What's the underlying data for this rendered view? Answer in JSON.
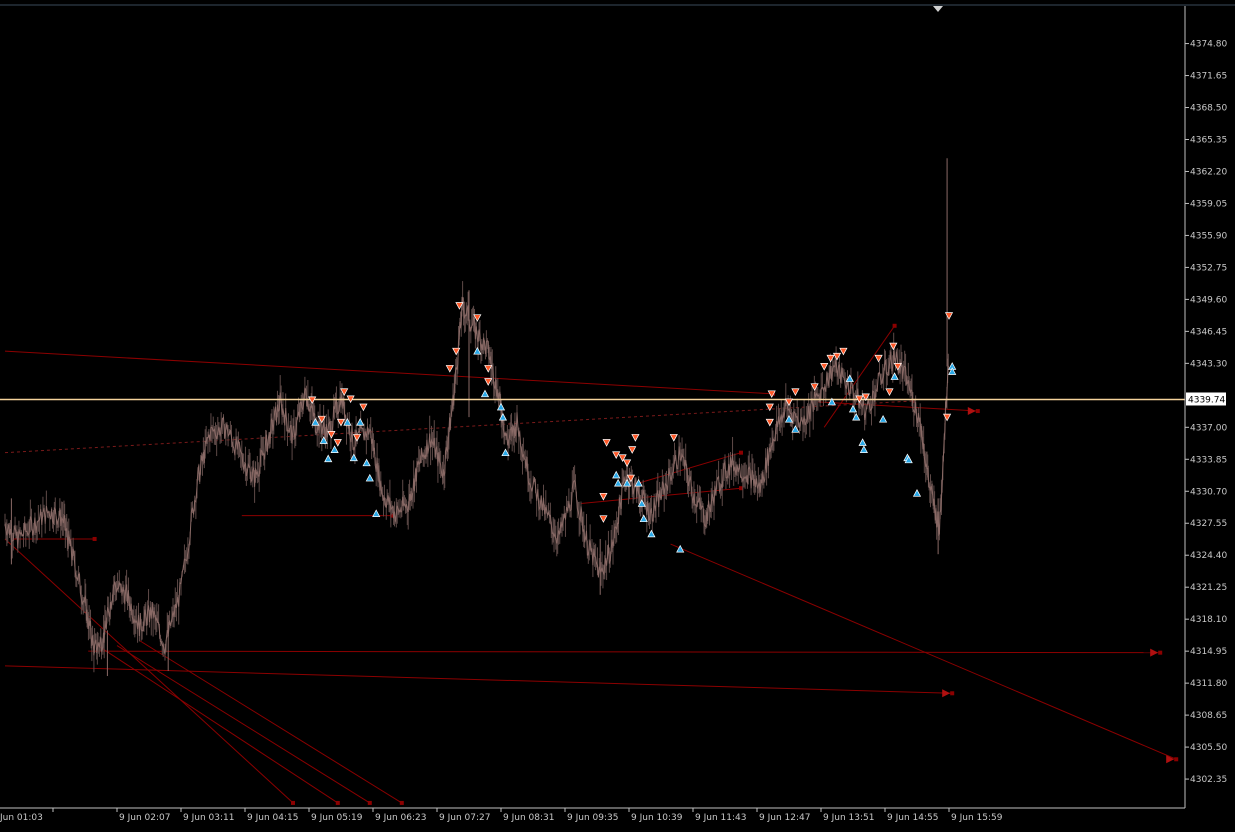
{
  "chart_data": {
    "type": "candlestick-line",
    "title": "",
    "xlabel": "",
    "ylabel": "",
    "ylim": [
      4299.5,
      4378.5
    ],
    "grid": false,
    "current_price": "4339.74",
    "x_ticks": [
      "Jun 01:03",
      "9 Jun 02:07",
      "9 Jun 03:11",
      "9 Jun 04:15",
      "9 Jun 05:19",
      "9 Jun 06:23",
      "9 Jun 07:27",
      "9 Jun 08:31",
      "9 Jun 09:35",
      "9 Jun 10:39",
      "9 Jun 11:43",
      "9 Jun 12:47",
      "9 Jun 13:51",
      "9 Jun 14:55",
      "9 Jun 15:59"
    ],
    "y_ticks": [
      "4374.80",
      "4371.65",
      "4368.50",
      "4365.35",
      "4362.20",
      "4359.05",
      "4355.90",
      "4352.75",
      "4349.60",
      "4346.45",
      "4343.30",
      "4337.00",
      "4333.85",
      "4330.70",
      "4327.55",
      "4324.40",
      "4321.25",
      "4318.10",
      "4314.95",
      "4311.80",
      "4308.65",
      "4305.50",
      "4302.35"
    ],
    "y_tick_values": [
      4374.8,
      4371.65,
      4368.5,
      4365.35,
      4362.2,
      4359.05,
      4355.9,
      4352.75,
      4349.6,
      4346.45,
      4343.3,
      4337.0,
      4333.85,
      4330.7,
      4327.55,
      4324.4,
      4321.25,
      4318.1,
      4314.95,
      4311.8,
      4308.65,
      4305.5,
      4302.35
    ],
    "x_tick_units": [
      0.4,
      1.4,
      2.4,
      3.4,
      4.4,
      5.4,
      6.4,
      7.4,
      8.4,
      9.4,
      10.4,
      11.4,
      12.4,
      13.4,
      14.4
    ],
    "x_max_units": 18.5,
    "price_path": [
      [
        0.0,
        4327.5
      ],
      [
        0.2,
        4326.0
      ],
      [
        0.45,
        4327.5
      ],
      [
        0.7,
        4328.8
      ],
      [
        0.9,
        4328.0
      ],
      [
        1.05,
        4324.5
      ],
      [
        1.25,
        4319.5
      ],
      [
        1.4,
        4315.0
      ],
      [
        1.55,
        4316.5
      ],
      [
        1.7,
        4321.5
      ],
      [
        1.9,
        4320.5
      ],
      [
        2.1,
        4317.5
      ],
      [
        2.3,
        4318.8
      ],
      [
        2.5,
        4315.5
      ],
      [
        2.75,
        4321.0
      ],
      [
        3.0,
        4331.5
      ],
      [
        3.2,
        4336.5
      ],
      [
        3.45,
        4337.0
      ],
      [
        3.7,
        4334.0
      ],
      [
        3.9,
        4332.0
      ],
      [
        4.1,
        4335.5
      ],
      [
        4.3,
        4339.5
      ],
      [
        4.5,
        4336.0
      ],
      [
        4.7,
        4340.5
      ],
      [
        4.85,
        4337.5
      ],
      [
        5.05,
        4336.5
      ],
      [
        5.25,
        4340.0
      ],
      [
        5.45,
        4335.5
      ],
      [
        5.7,
        4336.8
      ],
      [
        5.9,
        4330.5
      ],
      [
        6.1,
        4328.5
      ],
      [
        6.3,
        4329.5
      ],
      [
        6.45,
        4333.0
      ],
      [
        6.65,
        4336.0
      ],
      [
        6.85,
        4332.5
      ],
      [
        7.0,
        4339.5
      ],
      [
        7.15,
        4349.0
      ],
      [
        7.35,
        4346.5
      ],
      [
        7.55,
        4344.5
      ],
      [
        7.7,
        4340.5
      ],
      [
        7.85,
        4335.5
      ],
      [
        8.0,
        4337.5
      ],
      [
        8.2,
        4332.0
      ],
      [
        8.45,
        4328.5
      ],
      [
        8.65,
        4326.0
      ],
      [
        8.9,
        4331.0
      ],
      [
        9.1,
        4325.5
      ],
      [
        9.3,
        4322.5
      ],
      [
        9.5,
        4325.5
      ],
      [
        9.7,
        4332.5
      ],
      [
        9.9,
        4330.5
      ],
      [
        10.1,
        4328.5
      ],
      [
        10.3,
        4331.0
      ],
      [
        10.55,
        4334.5
      ],
      [
        10.75,
        4330.5
      ],
      [
        10.95,
        4328.0
      ],
      [
        11.15,
        4331.5
      ],
      [
        11.35,
        4333.5
      ],
      [
        11.6,
        4332.5
      ],
      [
        11.8,
        4331.0
      ],
      [
        12.0,
        4336.0
      ],
      [
        12.2,
        4339.0
      ],
      [
        12.45,
        4337.5
      ],
      [
        12.7,
        4340.0
      ],
      [
        12.95,
        4343.0
      ],
      [
        13.2,
        4341.0
      ],
      [
        13.45,
        4338.5
      ],
      [
        13.7,
        4342.0
      ],
      [
        13.9,
        4344.0
      ],
      [
        14.1,
        4341.5
      ],
      [
        14.3,
        4337.5
      ],
      [
        14.45,
        4331.0
      ],
      [
        14.6,
        4327.0
      ],
      [
        14.75,
        4345.0
      ]
    ],
    "candle_extremes": [
      [
        0.1,
        4323.5,
        4330.0
      ],
      [
        1.6,
        4312.5,
        4317.0
      ],
      [
        2.55,
        4313.0,
        4318.5
      ],
      [
        7.25,
        4350.5,
        4338.0
      ],
      [
        9.3,
        4320.5,
        4326.0
      ],
      [
        14.58,
        4324.5,
        4330.0
      ],
      [
        14.72,
        4343.0,
        4363.5
      ]
    ],
    "lines": [
      {
        "style": "solid",
        "color": "#8b0000",
        "from": [
          0.0,
          4344.5
        ],
        "to": [
          12.0,
          4340.3
        ]
      },
      {
        "style": "dashed",
        "color": "#7a1a1a",
        "from": [
          0.0,
          4334.5
        ],
        "to": [
          14.2,
          4339.6
        ]
      },
      {
        "style": "solid",
        "color": "#8b0000",
        "from": [
          0.1,
          4326.0
        ],
        "to": [
          1.4,
          4326.0
        ]
      },
      {
        "style": "solid",
        "color": "#8b0000",
        "from": [
          3.7,
          4328.3
        ],
        "to": [
          6.05,
          4328.3
        ]
      },
      {
        "style": "solid",
        "color": "#8b0000",
        "from": [
          1.3,
          4314.95
        ],
        "to": [
          18.05,
          4314.8
        ]
      },
      {
        "style": "solid",
        "color": "#8b0000",
        "from": [
          0.0,
          4313.5
        ],
        "to": [
          14.8,
          4310.8
        ]
      },
      {
        "style": "solid",
        "color": "#8b0000",
        "from": [
          10.4,
          4325.5
        ],
        "to": [
          18.3,
          4304.3
        ]
      },
      {
        "style": "solid",
        "color": "#8b0000",
        "from": [
          0.0,
          4326.0
        ],
        "to": [
          4.5,
          4300.0
        ]
      },
      {
        "style": "solid",
        "color": "#8b0000",
        "from": [
          1.45,
          4315.5
        ],
        "to": [
          5.2,
          4300.0
        ]
      },
      {
        "style": "solid",
        "color": "#8b0000",
        "from": [
          1.75,
          4315.5
        ],
        "to": [
          5.7,
          4300.0
        ]
      },
      {
        "style": "solid",
        "color": "#8b0000",
        "from": [
          2.1,
          4316.0
        ],
        "to": [
          6.2,
          4300.0
        ]
      },
      {
        "style": "solid",
        "color": "#8b0000",
        "from": [
          12.8,
          4337.0
        ],
        "to": [
          13.9,
          4347.0
        ]
      },
      {
        "style": "solid",
        "color": "#8b0000",
        "from": [
          12.7,
          4339.5
        ],
        "to": [
          15.2,
          4338.6
        ]
      },
      {
        "style": "solid",
        "color": "#8b0000",
        "from": [
          9.9,
          4331.5
        ],
        "to": [
          11.5,
          4334.5
        ]
      },
      {
        "style": "solid",
        "color": "#8b0000",
        "from": [
          9.0,
          4329.5
        ],
        "to": [
          11.5,
          4331.0
        ]
      }
    ],
    "signal_markers": [
      {
        "kind": "sell",
        "x": 4.8,
        "y": 4339.7
      },
      {
        "kind": "buy",
        "x": 4.85,
        "y": 4337.5
      },
      {
        "kind": "sell",
        "x": 4.95,
        "y": 4337.8
      },
      {
        "kind": "buy",
        "x": 4.98,
        "y": 4335.7
      },
      {
        "kind": "buy",
        "x": 5.05,
        "y": 4333.9
      },
      {
        "kind": "sell",
        "x": 5.1,
        "y": 4336.3
      },
      {
        "kind": "buy",
        "x": 5.15,
        "y": 4334.8
      },
      {
        "kind": "sell",
        "x": 5.2,
        "y": 4335.5
      },
      {
        "kind": "sell",
        "x": 5.25,
        "y": 4337.5
      },
      {
        "kind": "sell",
        "x": 5.3,
        "y": 4340.5
      },
      {
        "kind": "buy",
        "x": 5.35,
        "y": 4337.5
      },
      {
        "kind": "sell",
        "x": 5.4,
        "y": 4339.8
      },
      {
        "kind": "buy",
        "x": 5.45,
        "y": 4334.0
      },
      {
        "kind": "sell",
        "x": 5.5,
        "y": 4336.0
      },
      {
        "kind": "buy",
        "x": 5.55,
        "y": 4337.5
      },
      {
        "kind": "sell",
        "x": 5.6,
        "y": 4339.0
      },
      {
        "kind": "buy",
        "x": 5.65,
        "y": 4333.5
      },
      {
        "kind": "buy",
        "x": 5.7,
        "y": 4332.0
      },
      {
        "kind": "buy",
        "x": 5.8,
        "y": 4328.5
      },
      {
        "kind": "sell",
        "x": 6.95,
        "y": 4342.8
      },
      {
        "kind": "sell",
        "x": 7.05,
        "y": 4344.5
      },
      {
        "kind": "sell",
        "x": 7.1,
        "y": 4349.0
      },
      {
        "kind": "buy",
        "x": 7.38,
        "y": 4344.5
      },
      {
        "kind": "sell",
        "x": 7.38,
        "y": 4347.8
      },
      {
        "kind": "sell",
        "x": 7.55,
        "y": 4342.8
      },
      {
        "kind": "sell",
        "x": 7.55,
        "y": 4341.5
      },
      {
        "kind": "buy",
        "x": 7.5,
        "y": 4340.3
      },
      {
        "kind": "buy",
        "x": 7.75,
        "y": 4339.0
      },
      {
        "kind": "buy",
        "x": 7.78,
        "y": 4338.0
      },
      {
        "kind": "buy",
        "x": 7.82,
        "y": 4334.5
      },
      {
        "kind": "sell",
        "x": 9.4,
        "y": 4335.5
      },
      {
        "kind": "sell",
        "x": 9.55,
        "y": 4334.3
      },
      {
        "kind": "sell",
        "x": 9.65,
        "y": 4334.0
      },
      {
        "kind": "sell",
        "x": 9.72,
        "y": 4333.5
      },
      {
        "kind": "sell",
        "x": 9.8,
        "y": 4334.8
      },
      {
        "kind": "sell",
        "x": 9.85,
        "y": 4336.0
      },
      {
        "kind": "sell",
        "x": 9.78,
        "y": 4332.0
      },
      {
        "kind": "buy",
        "x": 9.55,
        "y": 4332.3
      },
      {
        "kind": "buy",
        "x": 9.58,
        "y": 4331.5
      },
      {
        "kind": "buy",
        "x": 9.72,
        "y": 4331.5
      },
      {
        "kind": "buy",
        "x": 9.9,
        "y": 4331.5
      },
      {
        "kind": "buy",
        "x": 9.95,
        "y": 4329.5
      },
      {
        "kind": "buy",
        "x": 9.98,
        "y": 4328.0
      },
      {
        "kind": "buy",
        "x": 10.1,
        "y": 4326.5
      },
      {
        "kind": "sell",
        "x": 9.35,
        "y": 4330.2
      },
      {
        "kind": "sell",
        "x": 9.35,
        "y": 4328.0
      },
      {
        "kind": "sell",
        "x": 10.45,
        "y": 4336.0
      },
      {
        "kind": "buy",
        "x": 10.55,
        "y": 4325.0
      },
      {
        "kind": "sell",
        "x": 11.95,
        "y": 4337.5
      },
      {
        "kind": "sell",
        "x": 11.95,
        "y": 4339.0
      },
      {
        "kind": "sell",
        "x": 11.98,
        "y": 4340.3
      },
      {
        "kind": "buy",
        "x": 12.25,
        "y": 4337.8
      },
      {
        "kind": "buy",
        "x": 12.35,
        "y": 4336.8
      },
      {
        "kind": "sell",
        "x": 12.25,
        "y": 4339.5
      },
      {
        "kind": "sell",
        "x": 12.35,
        "y": 4340.5
      },
      {
        "kind": "sell",
        "x": 12.65,
        "y": 4341.0
      },
      {
        "kind": "sell",
        "x": 12.8,
        "y": 4343.0
      },
      {
        "kind": "sell",
        "x": 12.9,
        "y": 4343.8
      },
      {
        "kind": "sell",
        "x": 13.0,
        "y": 4344.0
      },
      {
        "kind": "sell",
        "x": 13.1,
        "y": 4344.5
      },
      {
        "kind": "buy",
        "x": 12.92,
        "y": 4339.5
      },
      {
        "kind": "buy",
        "x": 13.2,
        "y": 4341.8
      },
      {
        "kind": "buy",
        "x": 13.25,
        "y": 4338.8
      },
      {
        "kind": "buy",
        "x": 13.3,
        "y": 4338.0
      },
      {
        "kind": "sell",
        "x": 13.35,
        "y": 4339.8
      },
      {
        "kind": "sell",
        "x": 13.45,
        "y": 4340.0
      },
      {
        "kind": "buy",
        "x": 13.4,
        "y": 4335.5
      },
      {
        "kind": "buy",
        "x": 13.42,
        "y": 4334.8
      },
      {
        "kind": "sell",
        "x": 13.65,
        "y": 4343.8
      },
      {
        "kind": "buy",
        "x": 13.72,
        "y": 4337.8
      },
      {
        "kind": "sell",
        "x": 13.82,
        "y": 4340.5
      },
      {
        "kind": "sell",
        "x": 13.88,
        "y": 4345.0
      },
      {
        "kind": "buy",
        "x": 13.9,
        "y": 4342.0
      },
      {
        "kind": "sell",
        "x": 13.95,
        "y": 4343.0
      },
      {
        "kind": "buy",
        "x": 14.1,
        "y": 4334.0
      },
      {
        "kind": "buy",
        "x": 14.12,
        "y": 4333.8
      },
      {
        "kind": "buy",
        "x": 14.25,
        "y": 4330.5
      },
      {
        "kind": "sell",
        "x": 14.75,
        "y": 4348.0
      },
      {
        "kind": "sell",
        "x": 14.72,
        "y": 4338.0
      },
      {
        "kind": "buy",
        "x": 14.8,
        "y": 4343.0
      },
      {
        "kind": "buy",
        "x": 14.8,
        "y": 4342.5
      }
    ],
    "colors": {
      "background": "#000000",
      "price_line": "#8a6a66",
      "current_price_line": "#f5d39c",
      "price_label_bg": "#ffffff",
      "axis": "#c0c0c0",
      "trend_lines": "#8b0000",
      "sell_marker": "#ff5a2a",
      "buy_marker": "#2aa9e8"
    }
  }
}
